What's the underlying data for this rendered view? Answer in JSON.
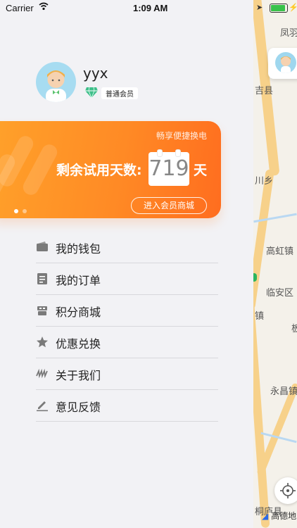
{
  "status_bar": {
    "carrier": "Carrier",
    "time": "1:09 AM"
  },
  "profile": {
    "username": "yyx",
    "level": "普通会员"
  },
  "card": {
    "hint": "畅享便捷换电",
    "label": "剩余试用天数:",
    "days": "719",
    "unit": "天",
    "mall_button": "进入会员商城",
    "page_count": 2,
    "active_page": 1
  },
  "menu": {
    "items": [
      {
        "label": "我的钱包",
        "icon": "wallet-icon"
      },
      {
        "label": "我的订单",
        "icon": "order-icon"
      },
      {
        "label": "积分商城",
        "icon": "points-mall-icon"
      },
      {
        "label": "优惠兑换",
        "icon": "star-icon"
      },
      {
        "label": "关于我们",
        "icon": "about-icon"
      },
      {
        "label": "意见反馈",
        "icon": "feedback-icon"
      }
    ]
  },
  "map": {
    "places": [
      "凤羽",
      "吉县",
      "川乡",
      "高虹镇",
      "临安区",
      "镇",
      "永昌镇",
      "桐庐县",
      "板"
    ],
    "logo_text": "高德地"
  },
  "colors": {
    "accent": "#ff8a25",
    "menu_icon": "#7a7a7a",
    "map_road": "#f7d18a"
  }
}
